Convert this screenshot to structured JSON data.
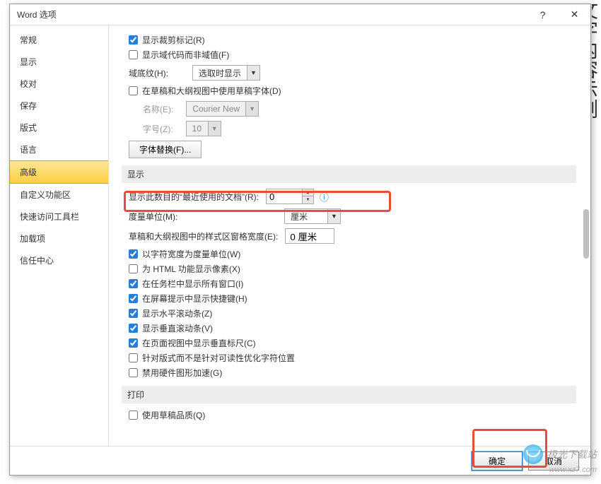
{
  "titlebar": {
    "title": "Word 选项",
    "help": "?",
    "close": "✕"
  },
  "sidebar": {
    "items": [
      {
        "label": "常规"
      },
      {
        "label": "显示"
      },
      {
        "label": "校对"
      },
      {
        "label": "保存"
      },
      {
        "label": "版式"
      },
      {
        "label": "语言"
      },
      {
        "label": "高级"
      },
      {
        "label": "自定义功能区"
      },
      {
        "label": "快速访问工具栏"
      },
      {
        "label": "加载项"
      },
      {
        "label": "信任中心"
      }
    ]
  },
  "content": {
    "checkboxes_top": [
      {
        "label": "显示裁剪标记(R)",
        "checked": true
      },
      {
        "label": "显示域代码而非域值(F)",
        "checked": false
      }
    ],
    "field_shading": {
      "label": "域底纹(H):",
      "value": "选取时显示"
    },
    "draft_font": {
      "label": "在草稿和大纲视图中使用草稿字体(D)",
      "checked": false,
      "name_label": "名称(E):",
      "name_value": "Courier New",
      "size_label": "字号(Z):",
      "size_value": "10"
    },
    "font_subst_btn": "字体替换(F)...",
    "section_display": "显示",
    "recent_docs": {
      "label": "显示此数目的“最近使用的文档”(R):",
      "value": "0"
    },
    "measure_unit": {
      "label": "度量单位(M):",
      "value": "厘米"
    },
    "style_area": {
      "label": "草稿和大纲视图中的样式区窗格宽度(E):",
      "value": "0 厘米"
    },
    "checkboxes_display": [
      {
        "label": "以字符宽度为度量单位(W)",
        "checked": true
      },
      {
        "label": "为 HTML 功能显示像素(X)",
        "checked": false
      },
      {
        "label": "在任务栏中显示所有窗口(I)",
        "checked": true
      },
      {
        "label": "在屏幕提示中显示快捷键(H)",
        "checked": true
      },
      {
        "label": "显示水平滚动条(Z)",
        "checked": true
      },
      {
        "label": "显示垂直滚动条(V)",
        "checked": true
      },
      {
        "label": "在页面视图中显示垂直标尺(C)",
        "checked": true
      },
      {
        "label": "针对版式而不是针对可读性优化字符位置",
        "checked": false
      },
      {
        "label": "禁用硬件图形加速(G)",
        "checked": false
      }
    ],
    "section_print": "打印",
    "print_draft": {
      "label": "使用草稿品质(Q)",
      "checked": false
    }
  },
  "footer": {
    "ok": "确定",
    "cancel": "取消"
  },
  "watermark": {
    "text": "极光下载站",
    "url": "www.xz7.com"
  }
}
